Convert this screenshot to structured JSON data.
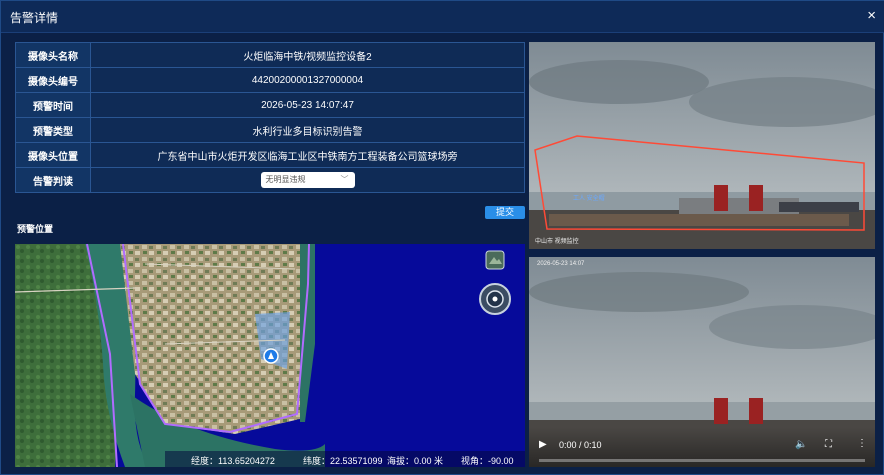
{
  "dialog": {
    "title": "告警详情",
    "close_symbol": "×"
  },
  "info": {
    "rows": [
      {
        "label": "摄像头名称",
        "value": "火炬临海中铁/视频监控设备2"
      },
      {
        "label": "摄像头编号",
        "value": "44200200001327000004"
      },
      {
        "label": "预警时间",
        "value": "2026-05-23 14:07:47"
      },
      {
        "label": "预警类型",
        "value": "水利行业多目标识别告警"
      },
      {
        "label": "摄像头位置",
        "value": "广东省中山市火炬开发区临海工业区中铁南方工程装备公司篮球场旁"
      }
    ],
    "judgment": {
      "label": "告警判读",
      "selected": "无明显违规"
    }
  },
  "submit_label": "提交",
  "location_title": "预警位置",
  "map": {
    "longitude": "经度：113.65204272",
    "latitude": "纬度：22.53571099",
    "altitude": "海拔：0.00 米",
    "view_angle": "视角：-90.00"
  },
  "camera1": {
    "detection_label": "工人 安全帽",
    "watermark": "中山市 视频监控"
  },
  "camera2": {
    "timestamp": "2026-05-23 14:07",
    "time": "0:00 / 0:10"
  },
  "colors": {
    "header": "#0e2a58",
    "panel": "#0b2046",
    "accent": "#2a8ee8",
    "map_water": "#060a9a",
    "boundary": "#b06cff",
    "alert_zone": "#ff4a36"
  }
}
